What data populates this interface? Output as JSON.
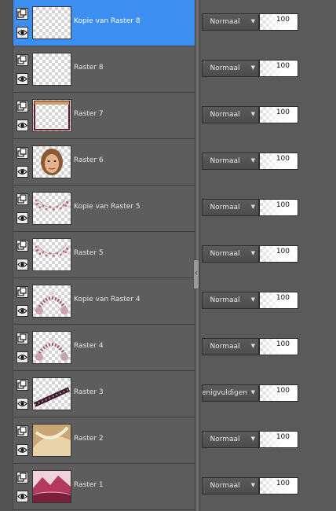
{
  "panel": {
    "layers": [
      {
        "name": "Kopie van Raster 8",
        "blend": "Normaal",
        "opacity": "100",
        "selected": true,
        "thumb": "empty"
      },
      {
        "name": "Raster 8",
        "blend": "Normaal",
        "opacity": "100",
        "selected": false,
        "thumb": "empty"
      },
      {
        "name": "Raster 7",
        "blend": "Normaal",
        "opacity": "100",
        "selected": false,
        "thumb": "frame"
      },
      {
        "name": "Raster 6",
        "blend": "Normaal",
        "opacity": "100",
        "selected": false,
        "thumb": "portrait"
      },
      {
        "name": "Kopie van Raster 5",
        "blend": "Normaal",
        "opacity": "100",
        "selected": false,
        "thumb": "sparkle-arc"
      },
      {
        "name": "Raster 5",
        "blend": "Normaal",
        "opacity": "100",
        "selected": false,
        "thumb": "sparkle-arc"
      },
      {
        "name": "Kopie van Raster 4",
        "blend": "Normaal",
        "opacity": "100",
        "selected": false,
        "thumb": "flower-arc"
      },
      {
        "name": "Raster 4",
        "blend": "Normaal",
        "opacity": "100",
        "selected": false,
        "thumb": "flower-arc"
      },
      {
        "name": "Raster 3",
        "blend": "Vermenigvuldigen",
        "opacity": "100",
        "selected": false,
        "thumb": "lace-strip"
      },
      {
        "name": "Raster 2",
        "blend": "Normaal",
        "opacity": "100",
        "selected": false,
        "thumb": "silk"
      },
      {
        "name": "Raster 1",
        "blend": "Normaal",
        "opacity": "100",
        "selected": false,
        "thumb": "landscape"
      }
    ]
  },
  "colors": {
    "selected": "#3c8ef0",
    "panel": "#5d5d5d",
    "background": "#5a5a5a"
  },
  "icons": {
    "layer_type": "raster-layer-icon",
    "visibility": "eye-icon",
    "dropdown": "chevron-down-icon"
  }
}
